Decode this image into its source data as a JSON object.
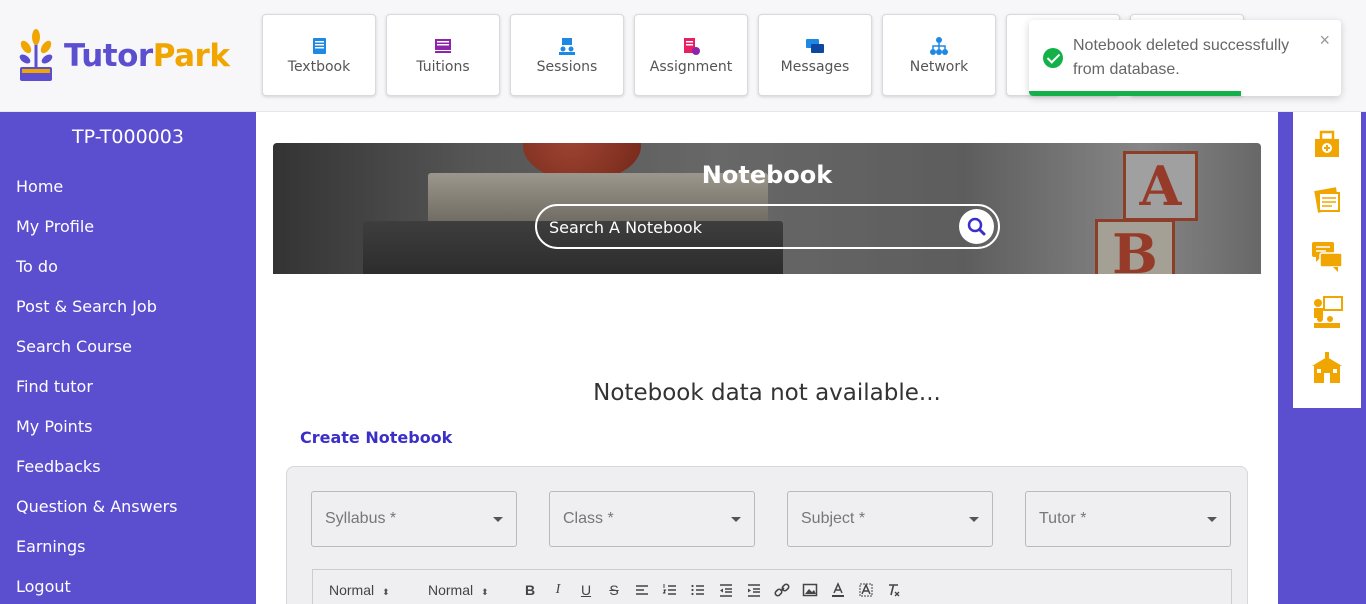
{
  "brand": {
    "part1": "Tutor",
    "part2": "Park"
  },
  "topnav": [
    {
      "label": "Textbook",
      "icon": "textbook-icon",
      "color": "#1e88e5"
    },
    {
      "label": "Tuitions",
      "icon": "tuitions-icon",
      "color": "#8e24aa"
    },
    {
      "label": "Sessions",
      "icon": "sessions-icon",
      "color": "#1e88e5"
    },
    {
      "label": "Assignment",
      "icon": "assignment-icon",
      "color": "#e91e63"
    },
    {
      "label": "Messages",
      "icon": "messages-icon",
      "color": "#1e88e5"
    },
    {
      "label": "Network",
      "icon": "network-icon",
      "color": "#1e88e5"
    }
  ],
  "toast": {
    "message": "Notebook deleted successfully from database.",
    "close": "×",
    "progress": 0.68,
    "color": "#14b14a"
  },
  "sidebar": {
    "user_id": "TP-T000003",
    "items": [
      "Home",
      "My Profile",
      "To do",
      "Post & Search Job",
      "Search Course",
      "Find tutor",
      "My Points",
      "Feedbacks",
      "Question & Answers",
      "Earnings",
      "Logout"
    ]
  },
  "right_icons": [
    "medical-kit-icon",
    "notebook-stack-icon",
    "chat-bubbles-icon",
    "classroom-icon",
    "school-icon"
  ],
  "notebook": {
    "title": "Notebook",
    "search_placeholder": "Search A Notebook",
    "empty_message": "Notebook data not available...",
    "create_link": "Create Notebook"
  },
  "form": {
    "selects": [
      "Syllabus *",
      "Class *",
      "Subject *",
      "Tutor *"
    ],
    "toolbar": {
      "font_size": "Normal",
      "heading": "Normal"
    }
  },
  "colors": {
    "primary": "#5b4fd0",
    "accent": "#f0a500",
    "link": "#3b2fc9"
  }
}
